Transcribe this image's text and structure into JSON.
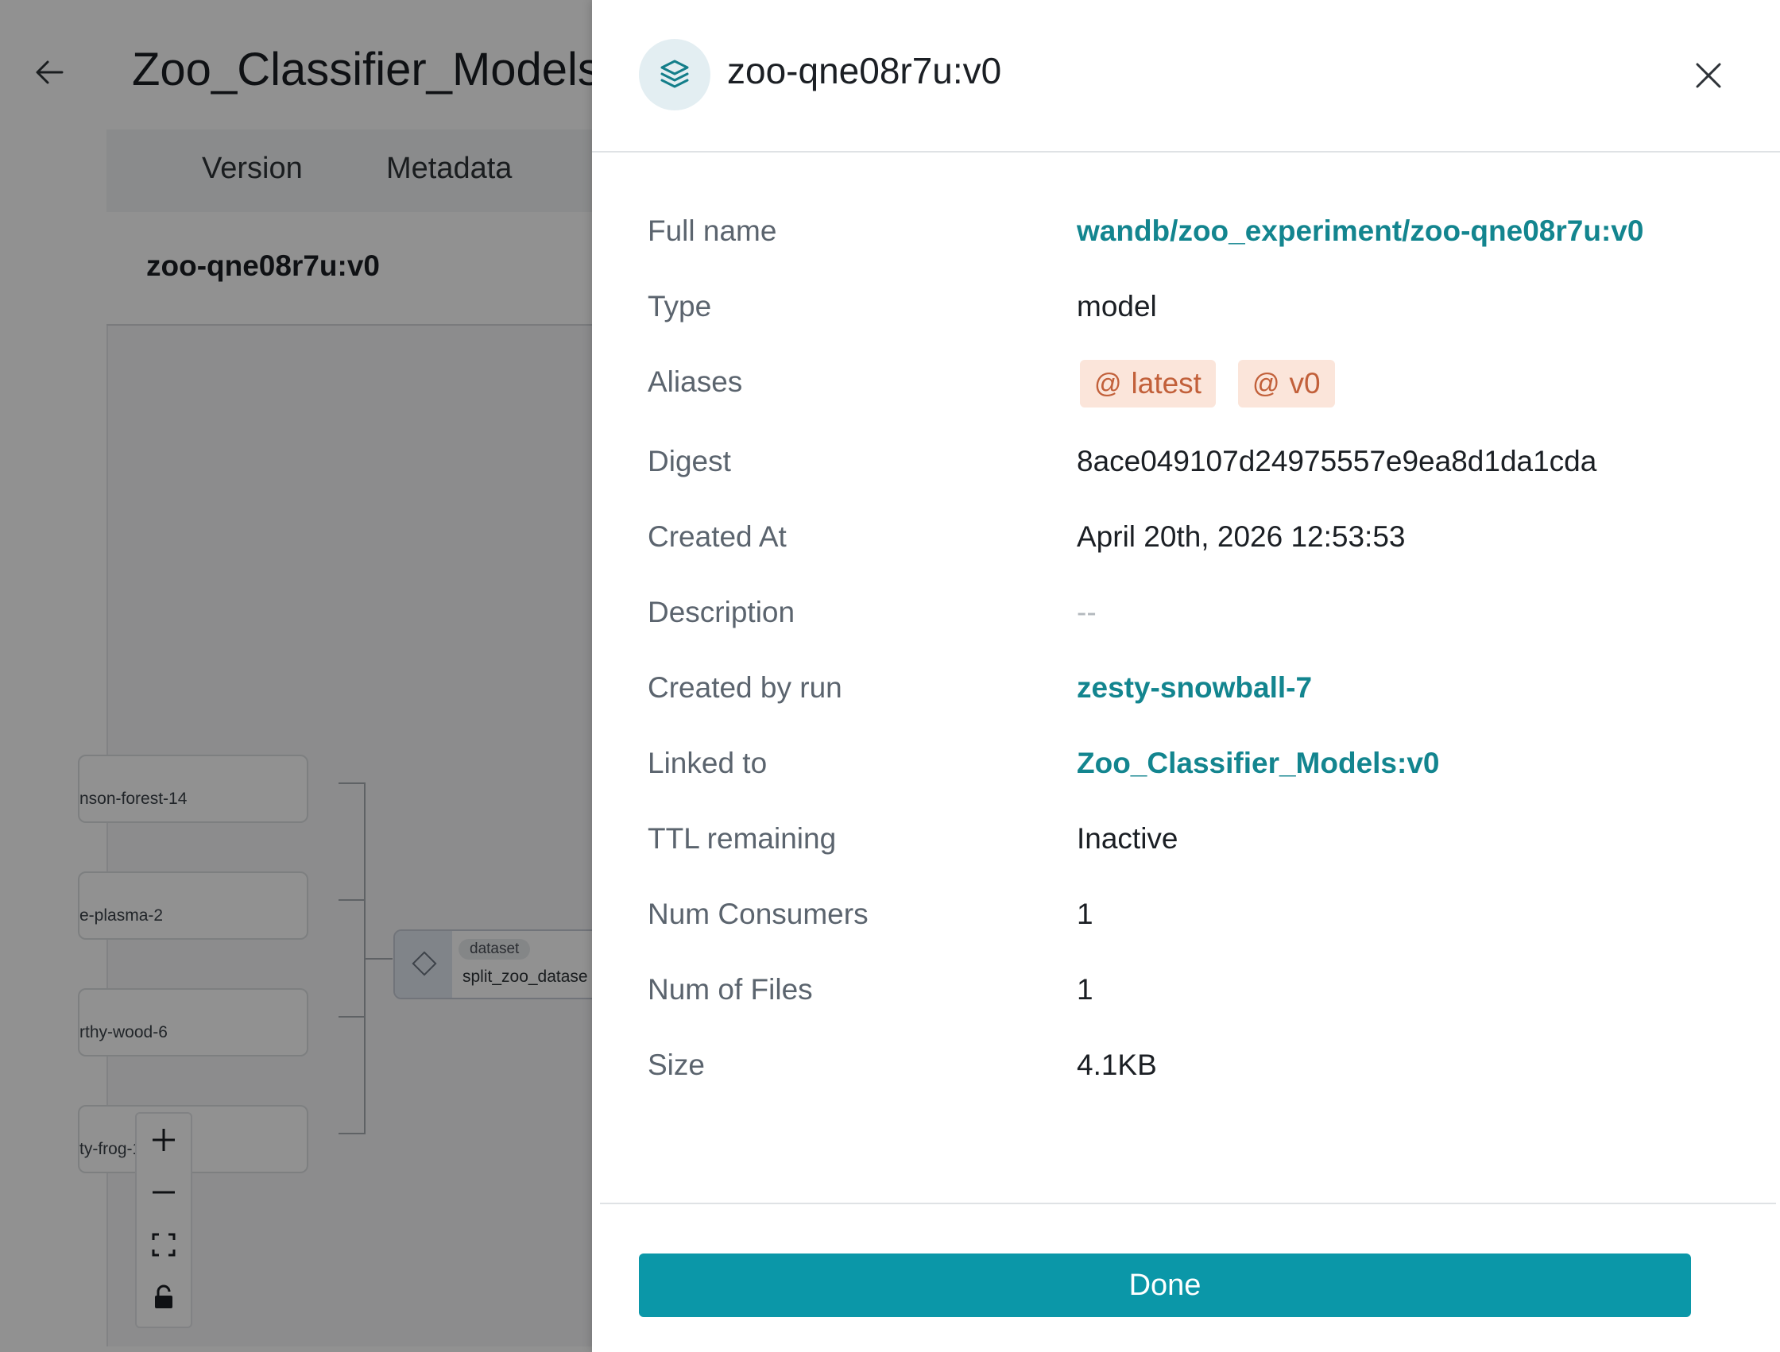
{
  "background": {
    "title": "Zoo_Classifier_Models",
    "tabs": [
      "Version",
      "Metadata"
    ],
    "version_label": "zoo-qne08r7u:v0",
    "runs": [
      "nson-forest-14",
      "e-plasma-2",
      "rthy-wood-6",
      "ty-frog-10"
    ],
    "dataset_node": {
      "badge": "dataset",
      "name": "split_zoo_datase"
    }
  },
  "drawer": {
    "title": "zoo-qne08r7u:v0",
    "fields": {
      "full_name": {
        "label": "Full name",
        "value": "wandb/zoo_experiment/zoo-qne08r7u:v0"
      },
      "type": {
        "label": "Type",
        "value": "model"
      },
      "aliases": {
        "label": "Aliases",
        "values": [
          "latest",
          "v0"
        ]
      },
      "digest": {
        "label": "Digest",
        "value": "8ace049107d24975557e9ea8d1da1cda"
      },
      "created_at": {
        "label": "Created At",
        "value": "April 20th, 2026 12:53:53"
      },
      "description": {
        "label": "Description",
        "value": "--"
      },
      "created_by_run": {
        "label": "Created by run",
        "value": "zesty-snowball-7"
      },
      "linked_to": {
        "label": "Linked to",
        "value": "Zoo_Classifier_Models:v0"
      },
      "ttl_remaining": {
        "label": "TTL remaining",
        "value": "Inactive"
      },
      "num_consumers": {
        "label": "Num Consumers",
        "value": "1"
      },
      "num_files": {
        "label": "Num of Files",
        "value": "1"
      },
      "size": {
        "label": "Size",
        "value": "4.1KB"
      }
    },
    "done_label": "Done"
  },
  "icons": {
    "back": "arrow-left-icon",
    "artifact": "layers-icon",
    "close": "close-icon",
    "alias": "at-sign-icon",
    "zoom_in": "plus-icon",
    "zoom_out": "minus-icon",
    "fit": "fit-view-icon",
    "lock": "lock-icon"
  },
  "colors": {
    "accent": "#0b97a8",
    "link": "#13858f",
    "alias_bg": "#fbe5da",
    "alias_text": "#c2603a"
  }
}
